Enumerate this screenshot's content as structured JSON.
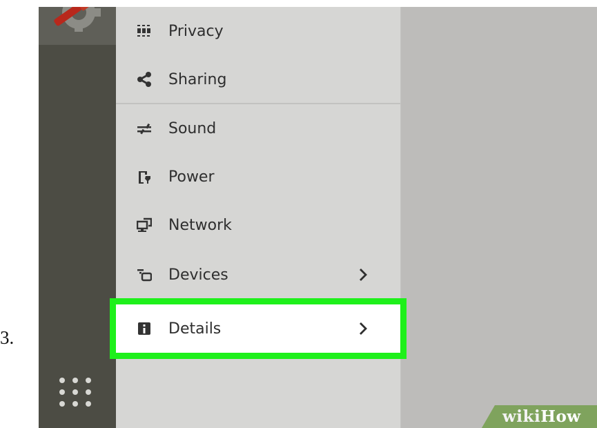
{
  "step_number": "3.",
  "dock": {
    "top_icon": "settings-app-icon",
    "bottom_icon": "show-applications-grid-icon"
  },
  "sidebar": {
    "items": [
      {
        "label": "Privacy",
        "icon": "privacy-icon",
        "has_chevron": false
      },
      {
        "label": "Sharing",
        "icon": "share-icon",
        "has_chevron": false
      },
      {
        "label": "Sound",
        "icon": "sound-sliders-icon",
        "has_chevron": false
      },
      {
        "label": "Power",
        "icon": "battery-plug-icon",
        "has_chevron": false
      },
      {
        "label": "Network",
        "icon": "network-icon",
        "has_chevron": false
      },
      {
        "label": "Devices",
        "icon": "devices-icon",
        "has_chevron": true
      },
      {
        "label": "Details",
        "icon": "info-icon",
        "has_chevron": true,
        "highlighted": true
      }
    ]
  },
  "watermark": {
    "wiki": "wiki",
    "how": "How"
  },
  "colors": {
    "dock": "#4c4c44",
    "sidebar": "#d6d6d4",
    "content": "#bdbcba",
    "highlight_outline": "#1ef01b",
    "watermark_bg": "#7fa35d"
  }
}
